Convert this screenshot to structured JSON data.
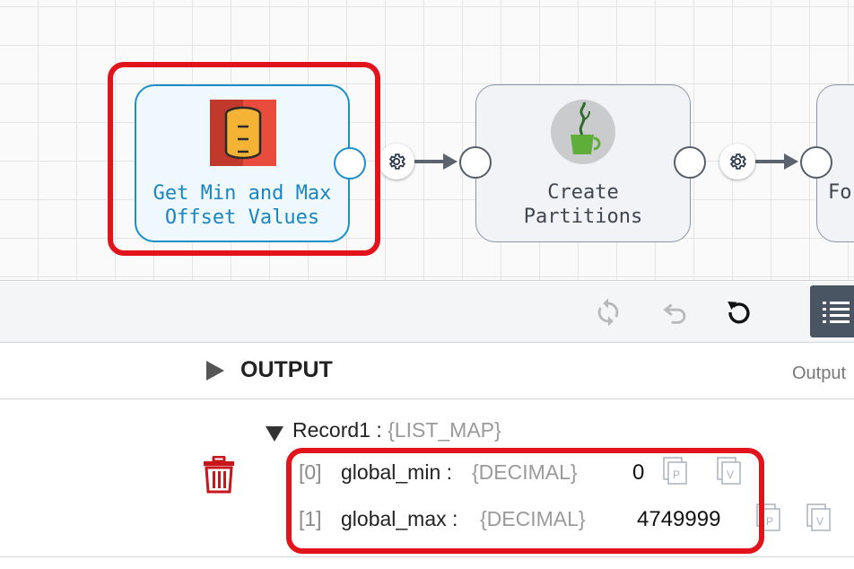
{
  "pipeline": {
    "stages": [
      {
        "label": "Get Min and Max\nOffset Values",
        "icon": "database-icon",
        "selected": true
      },
      {
        "label": "Create\nPartitions",
        "icon": "groovy-jar-icon",
        "selected": false
      },
      {
        "label": "Fo",
        "icon": "",
        "selected": false
      }
    ]
  },
  "toolbar": {
    "icons": [
      "refresh-icon",
      "undo-icon",
      "reset-icon",
      "list-view-icon"
    ]
  },
  "output": {
    "title": "OUTPUT",
    "right_label": "Output",
    "record": {
      "name": "Record1 :",
      "type": "{LIST_MAP}"
    },
    "fields": [
      {
        "index": "[0]",
        "name": "global_min :",
        "type": "{DECIMAL}",
        "value": "0"
      },
      {
        "index": "[1]",
        "name": "global_max :",
        "type": "{DECIMAL}",
        "value": "4749999"
      }
    ]
  },
  "colors": {
    "highlight": "#e3131b",
    "selected_border": "#1c8fc9",
    "delete_icon": "#c8161d"
  }
}
